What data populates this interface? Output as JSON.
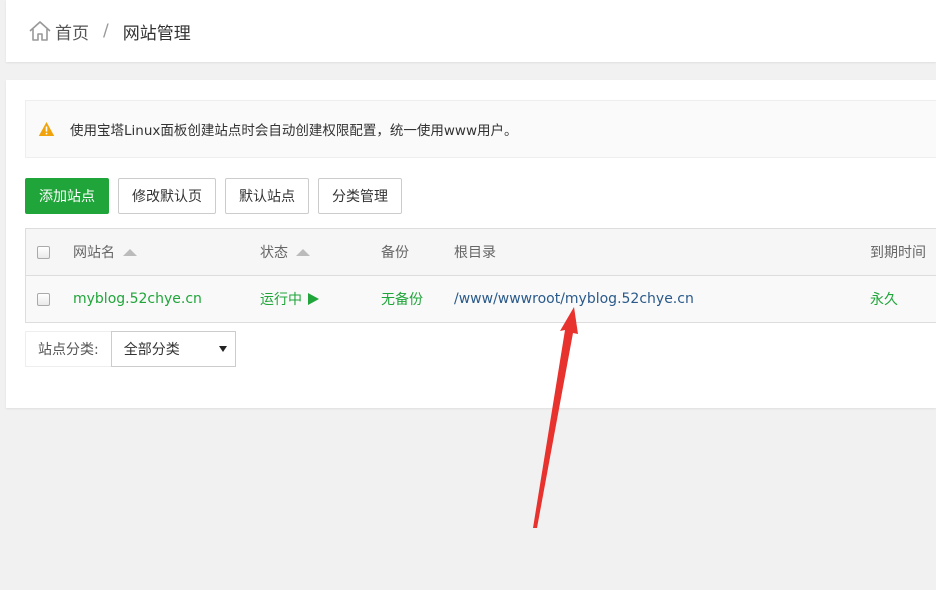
{
  "breadcrumb": {
    "home": "首页",
    "separator": "/",
    "current": "网站管理"
  },
  "alert": {
    "text": "使用宝塔Linux面板创建站点时会自动创建权限配置，统一使用www用户。"
  },
  "toolbar": {
    "add_site": "添加站点",
    "edit_default_page": "修改默认页",
    "default_site": "默认站点",
    "category_manage": "分类管理"
  },
  "table": {
    "headers": {
      "name": "网站名",
      "status": "状态",
      "backup": "备份",
      "root": "根目录",
      "expire": "到期时间"
    },
    "rows": [
      {
        "name": "myblog.52chye.cn",
        "status": "运行中",
        "backup": "无备份",
        "root": "/www/wwwroot/myblog.52chye.cn",
        "expire": "永久"
      }
    ]
  },
  "category": {
    "label": "站点分类:",
    "selected": "全部分类"
  },
  "colors": {
    "primary": "#20a53a",
    "warning": "#f0a30a",
    "annotation": "#e8322d"
  },
  "icons": {
    "home": "home-icon",
    "warning": "warning-icon",
    "running": "play-icon",
    "sort": "sort-up-icon"
  }
}
